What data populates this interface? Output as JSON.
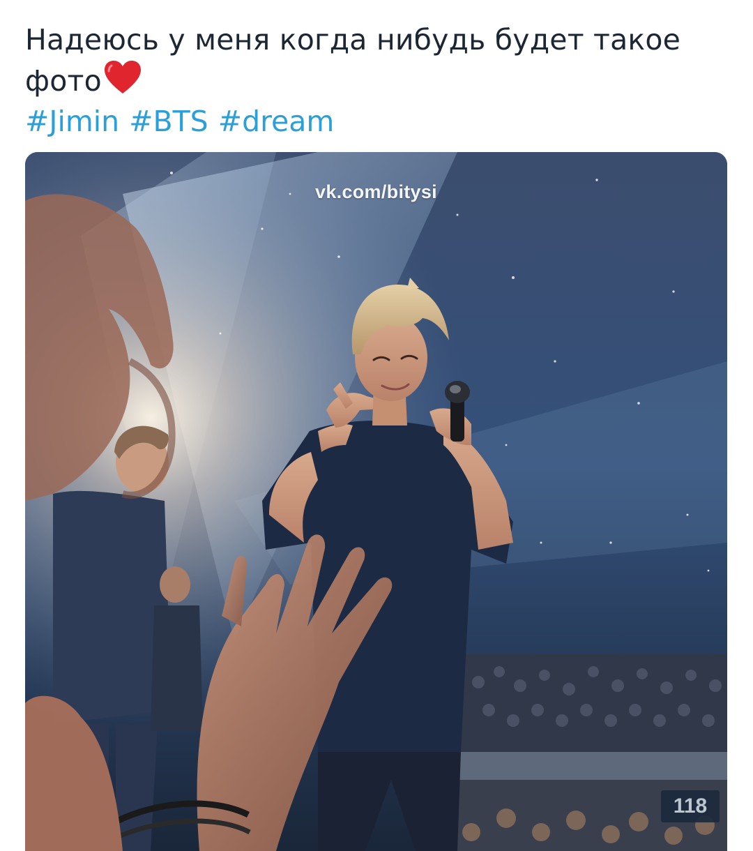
{
  "tweet": {
    "text": "Надеюсь у меня когда нибудь будет такое фото",
    "emoji_icon": "red-heart-icon",
    "hashtags": [
      "#Jimin",
      "#BTS",
      "#dream"
    ]
  },
  "media": {
    "watermark": "vk.com/bitysi",
    "section_sign": "118"
  },
  "colors": {
    "text": "#1c2733",
    "hashtag": "#2b9fd6",
    "heart": "#e0252f"
  }
}
